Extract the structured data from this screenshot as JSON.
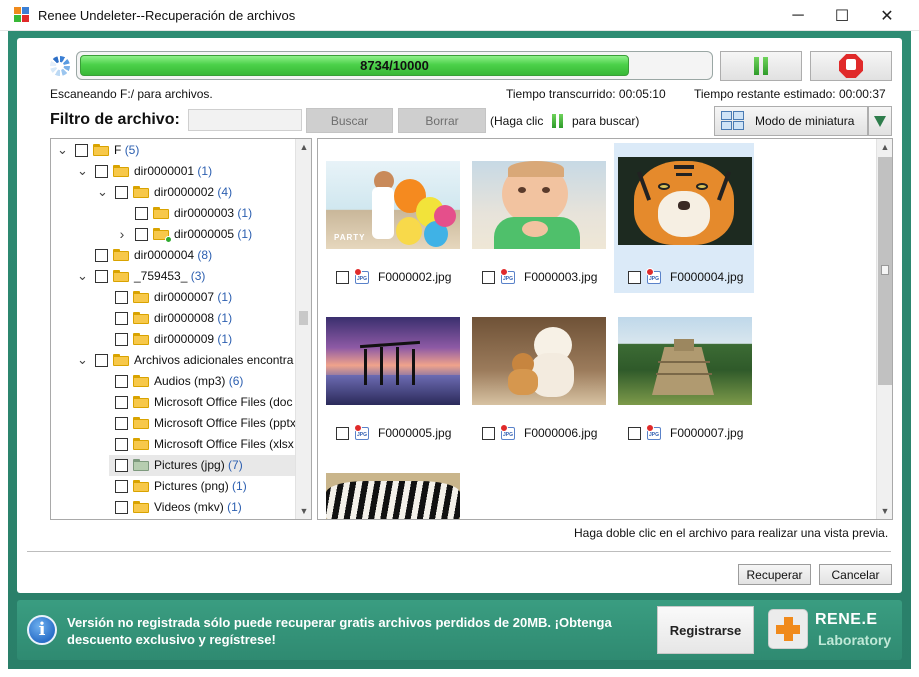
{
  "window": {
    "title": "Renee Undeleter--Recuperación de archivos",
    "minimize_glyph": "─",
    "maximize_glyph": "☐",
    "close_glyph": "✕"
  },
  "progress": {
    "text": "8734/10000",
    "fraction": 0.8734,
    "scanning_text": "Escaneando F:/ para archivos.",
    "elapsed_text": "Tiempo transcurrido: 00:05:10",
    "remaining_text": "Tiempo restante estimado: 00:00:37"
  },
  "filter": {
    "label": "Filtro de archivo:",
    "input_value": "",
    "search_label": "Buscar",
    "clear_label": "Borrar",
    "hint_before": "(Haga clic",
    "hint_after": "para buscar)"
  },
  "view_mode": {
    "label": "Modo de miniatura"
  },
  "tree": [
    {
      "label": "F",
      "count": "(5)",
      "chev": "down"
    },
    {
      "label": "dir0000001",
      "count": "(1)",
      "chev": "down"
    },
    {
      "label": "dir0000002",
      "count": "(4)",
      "chev": "down"
    },
    {
      "label": "dir0000003",
      "count": "(1)",
      "chev": ""
    },
    {
      "label": "dir0000005",
      "count": "(1)",
      "chev": "right"
    },
    {
      "label": "dir0000004",
      "count": "(8)",
      "chev": ""
    },
    {
      "label": "_759453_",
      "count": "(3)",
      "chev": "down"
    },
    {
      "label": "dir0000007",
      "count": "(1)",
      "chev": ""
    },
    {
      "label": "dir0000008",
      "count": "(1)",
      "chev": ""
    },
    {
      "label": "dir0000009",
      "count": "(1)",
      "chev": ""
    },
    {
      "label": "Archivos adicionales encontra",
      "count": "",
      "chev": "down"
    },
    {
      "label": "Audios (mp3)",
      "count": "(6)",
      "chev": ""
    },
    {
      "label": "Microsoft Office Files (doc",
      "count": "",
      "chev": ""
    },
    {
      "label": "Microsoft Office Files (pptx",
      "count": "",
      "chev": ""
    },
    {
      "label": "Microsoft Office Files (xlsx",
      "count": "",
      "chev": ""
    },
    {
      "label": "Pictures (jpg)",
      "count": "(7)",
      "chev": ""
    },
    {
      "label": "Pictures (png)",
      "count": "(1)",
      "chev": ""
    },
    {
      "label": "Videos (mkv)",
      "count": "(1)",
      "chev": ""
    }
  ],
  "files": [
    {
      "name": "F0000002.jpg",
      "thumb_text": "PARTY"
    },
    {
      "name": "F0000003.jpg"
    },
    {
      "name": "F0000004.jpg"
    },
    {
      "name": "F0000005.jpg"
    },
    {
      "name": "F0000006.jpg"
    },
    {
      "name": "F0000007.jpg"
    },
    {
      "name": ""
    }
  ],
  "preview_hint": "Haga doble clic en el archivo para realizar una vista previa.",
  "buttons": {
    "recover_label": "Recuperar",
    "cancel_label": "Cancelar"
  },
  "banner": {
    "message": "Versión no registrada sólo puede recuperar gratis archivos perdidos de 20MB. ¡Obtenga descuento exclusivo y regístrese!",
    "register_label": "Registrarse",
    "brand_name": "RENE.E",
    "brand_sub": "Laboratory"
  },
  "colors": {
    "frame_green": "#2e8c73",
    "progress_green": "#4cd14a",
    "stop_red": "#e02a2a",
    "count_blue": "#2c5fb0",
    "brand_orange": "#f08a1c"
  }
}
